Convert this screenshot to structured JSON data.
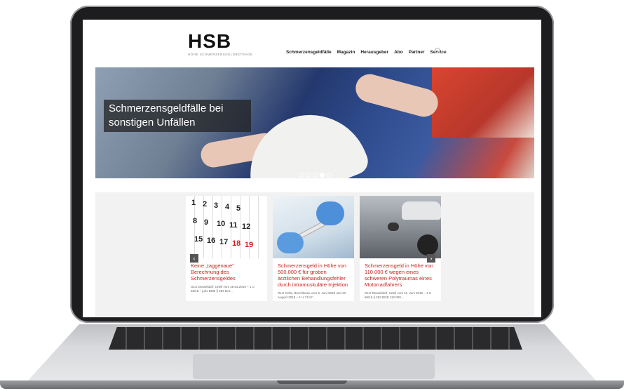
{
  "header": {
    "logo": "HSB",
    "logo_subtitle": "HOHE SCHMERZENSGELDBETRÄGE",
    "nav": [
      "Schmerzensgeldfälle",
      "Magazin",
      "Herausgeber",
      "Abo",
      "Partner",
      "Service"
    ]
  },
  "hero": {
    "caption": "Schmerzensgeldfälle bei sonstigen Unfällen",
    "slides_total": 5,
    "slide_active": 4
  },
  "cards": [
    {
      "title": "Keine „taggenaue“ Berechnung des Schmerzensgeldes",
      "meta": "OLG Düsseldorf, Urteil vom 28.03.2019 – 1 U 66/18 – juris BGB § 253 Der..."
    },
    {
      "title": "Schmerzensgeld in Höhe von 500.000 € für groben ärztlichen Behandlungsfehler durch intramuskuläre Injektion",
      "meta": "OLG Celle, Beschlüsse vom 5. Juni 2018 und 10. August 2018 – 1 U 71/17..."
    },
    {
      "title": "Schmerzensgeld in Höhe von 110.000 € wegen eines schweren Polytraumas eines Motorradfahrers",
      "meta": "OLG Düsseldorf, Urteil vom 11. Juni 2019 – 1 U 96/16 § 253 BGB 110.000..."
    }
  ],
  "calendar_numbers": [
    "1",
    "2",
    "3",
    "4",
    "5",
    "8",
    "9",
    "10",
    "11",
    "12",
    "15",
    "16",
    "17",
    "18",
    "19"
  ],
  "colors": {
    "accent_red": "#cc1f1f",
    "laptop_bezel": "#1d1d1f"
  },
  "icons": {
    "search": "search-icon",
    "prev": "chevron-left-icon",
    "next": "chevron-right-icon"
  }
}
